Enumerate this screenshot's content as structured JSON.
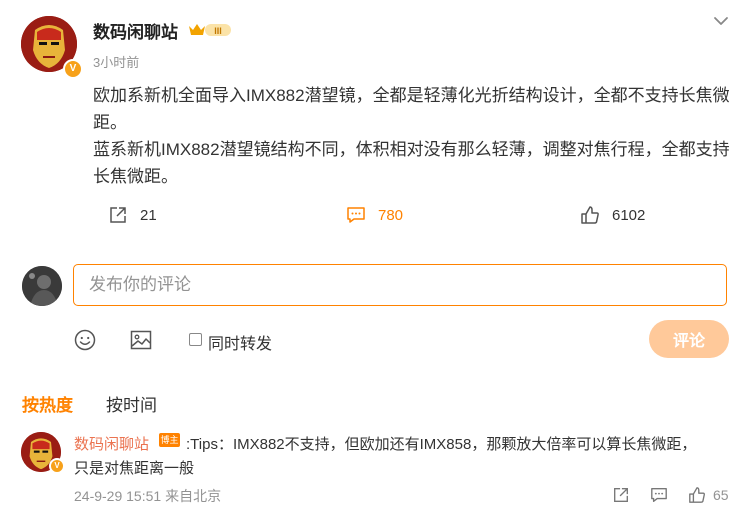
{
  "post": {
    "author": "数码闲聊站",
    "badge_text": "III",
    "time": "3小时前",
    "paragraphs": [
      "欧加系新机全面导入IMX882潜望镜，全都是轻薄化光折结构设计，全都不支持长焦微距。",
      "蓝系新机IMX882潜望镜结构不同，体积相对没有那么轻薄，调整对焦行程，全都支持长焦微距。"
    ],
    "actions": {
      "repost_count": "21",
      "comment_count": "780",
      "like_count": "6102"
    },
    "verified_mark": "V"
  },
  "composer": {
    "placeholder": "发布你的评论",
    "repost_label": "同时转发",
    "submit_label": "评论"
  },
  "sort": {
    "hot": "按热度",
    "time": "按时间"
  },
  "comments": [
    {
      "author": "数码闲聊站",
      "tag": "博主",
      "text_line1": ":Tips：IMX882不支持，但欧加还有IMX858，那颗放大倍率可以算长焦微距，",
      "text_line2": "只是对焦距离一般",
      "meta": "24-9-29 15:51 来自北京",
      "like_count": "65"
    }
  ],
  "colors": {
    "accent": "#ff8200",
    "muted": "#939393",
    "author_link": "#eb7350",
    "submit_disabled": "#ffc99a"
  },
  "icons": [
    "iron-man-avatar-icon",
    "crown-badge-icon",
    "chevron-down-icon",
    "repost-icon",
    "comment-icon",
    "like-icon",
    "emoji-icon",
    "image-icon"
  ]
}
